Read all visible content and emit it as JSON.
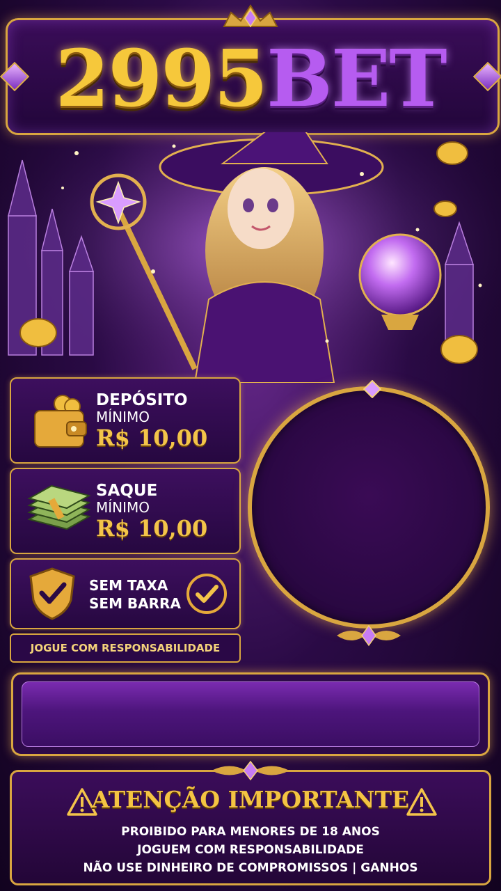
{
  "header": {
    "brand_number": "2995",
    "brand_suffix": "BET"
  },
  "cards": {
    "deposit": {
      "title": "DEPÓSITO",
      "subtitle": "MÍNIMO",
      "amount": "R$ 10,00",
      "icon": "wallet-icon"
    },
    "withdraw": {
      "title": "SAQUE",
      "subtitle": "MÍNIMO",
      "amount": "R$ 10,00",
      "icon": "cash-stack-icon"
    },
    "fees": {
      "line1": "SEM TAXA",
      "line2": "SEM BARRA",
      "icon": "shield-check-icon"
    }
  },
  "responsibility": "JOGUE COM RESPONSABILIDADE",
  "warning": {
    "title": "ATENÇÃO IMPORTANTE",
    "lines": [
      "PROIBIDO PARA MENORES DE 18 ANOS",
      "JOGUEM COM RESPONSABILIDADE",
      "NÃO USE DINHEIRO DE COMPROMISSOS | GANHOS"
    ],
    "icon": "warning-triangle-icon"
  },
  "colors": {
    "gold": "#d9a640",
    "purple": "#3d0f5e",
    "accent_purple": "#b65cf0"
  }
}
